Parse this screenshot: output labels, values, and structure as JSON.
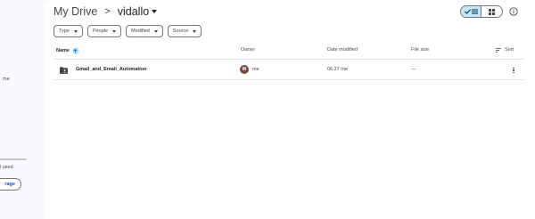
{
  "sidebar": {
    "owner_label": "me",
    "storage_used_text": "l used",
    "storage_button": "rage"
  },
  "breadcrumb": {
    "root": "My Drive",
    "separator": ">",
    "current": "vidallo"
  },
  "filters": [
    {
      "label": "Type"
    },
    {
      "label": "People"
    },
    {
      "label": "Modified"
    },
    {
      "label": "Source"
    }
  ],
  "columns": {
    "name": "Name",
    "owner": "Owner",
    "date_modified": "Date modified",
    "file_size": "File size",
    "sort": "Sort"
  },
  "rows": [
    {
      "name": "Gmail_and_Email_Automation",
      "owner_initial": "M",
      "owner": "me",
      "date_modified": "06:27 me",
      "file_size": "—"
    }
  ],
  "colors": {
    "accent": "#0b57d0",
    "selected_bg": "#c2e7ff",
    "avatar": "#6d4c41"
  },
  "icons": [
    "folder-shared-icon",
    "grid-view-icon",
    "list-view-icon",
    "check-icon",
    "info-icon",
    "arrow-up-icon",
    "sort-icon",
    "more-vert-icon",
    "chevron-down-icon"
  ]
}
